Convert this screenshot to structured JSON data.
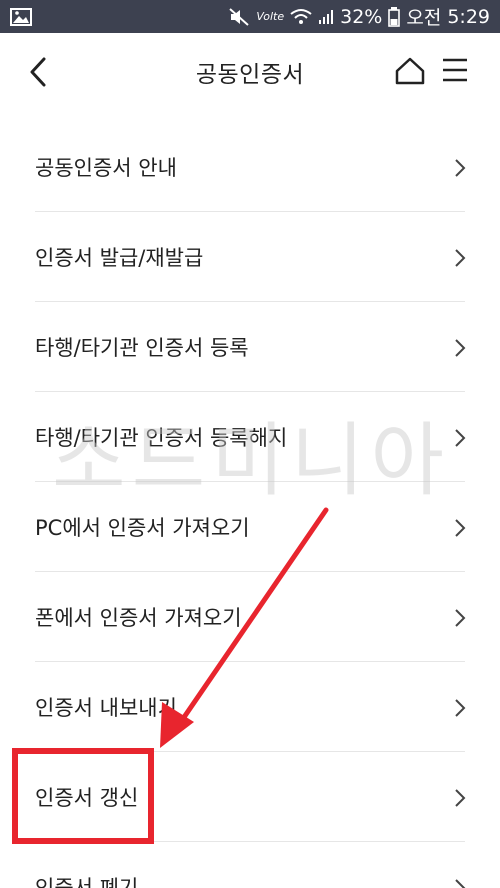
{
  "status_bar": {
    "battery": "32%",
    "ampm": "오전",
    "time": "5:29",
    "network_label": "Volte"
  },
  "header": {
    "title": "공동인증서"
  },
  "menu": {
    "items": [
      {
        "label": "공동인증서 안내"
      },
      {
        "label": "인증서 발급/재발급"
      },
      {
        "label": "타행/타기관 인증서 등록"
      },
      {
        "label": "타행/타기관 인증서 등록해지"
      },
      {
        "label": "PC에서 인증서 가져오기"
      },
      {
        "label": "폰에서 인증서 가져오기"
      },
      {
        "label": "인증서 내보내기"
      },
      {
        "label": "인증서 갱신"
      },
      {
        "label": "인증서 폐기"
      }
    ]
  },
  "watermark": "소드미니아",
  "colors": {
    "status_bar_bg": "#3d4150",
    "highlight": "#e8252e",
    "divider": "#e6e6e6"
  },
  "icons": {
    "back": "chevron-left-icon",
    "home": "home-icon",
    "menu": "hamburger-menu-icon",
    "row": "chevron-right-icon"
  }
}
